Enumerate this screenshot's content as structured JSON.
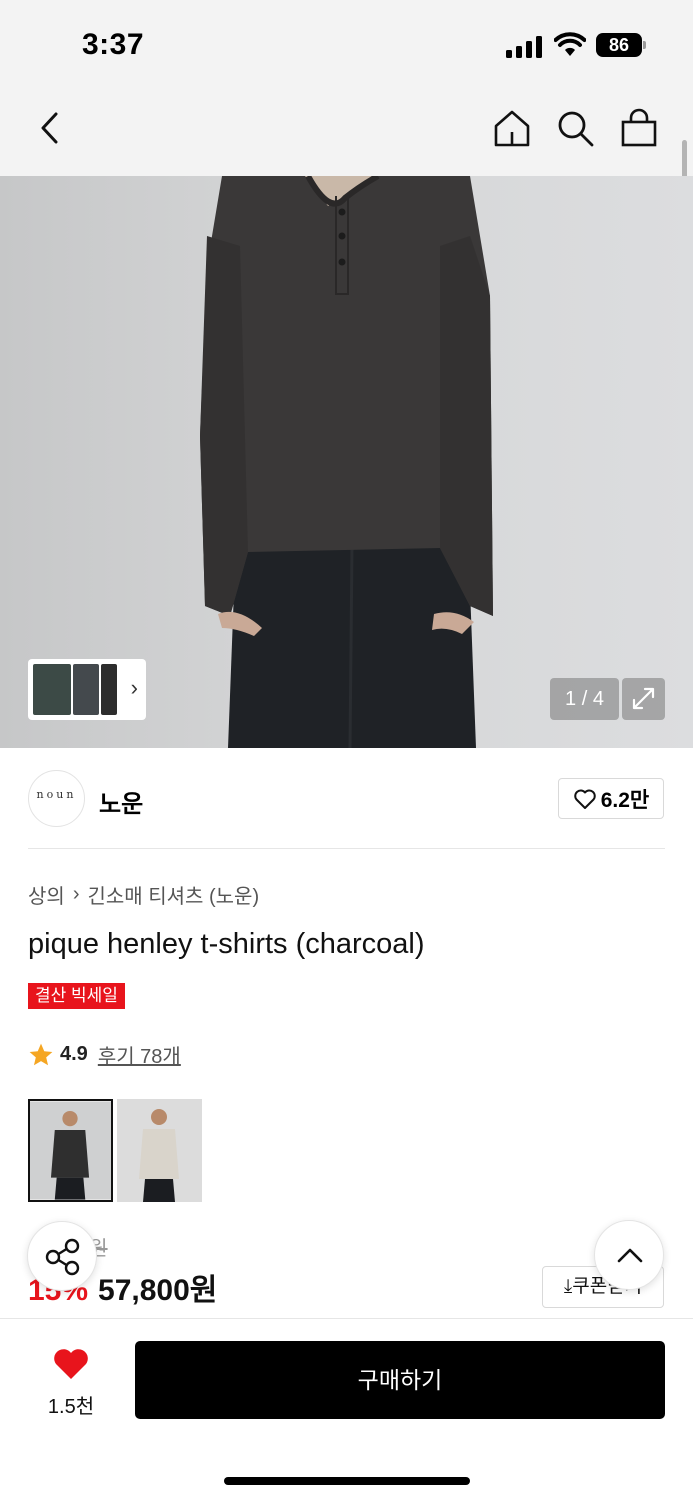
{
  "status_bar": {
    "time": "3:37",
    "battery": "86"
  },
  "nav": {
    "icons": [
      "back-icon",
      "home-icon",
      "search-icon",
      "shopping-bag-icon"
    ]
  },
  "gallery": {
    "counter": "1 / 4"
  },
  "brand": {
    "logo_text": "noun",
    "name": "노운",
    "like_count": "6.2만"
  },
  "product": {
    "breadcrumb": [
      "상의",
      "긴소매 티셔츠 (노운)"
    ],
    "title": "pique henley t-shirts (charcoal)",
    "badge": "결산 빅세일",
    "rating": "4.9",
    "reviews": "후기 78개",
    "colors": [
      {
        "name": "charcoal",
        "hex": "#2f2f2f",
        "selected": true
      },
      {
        "name": "oatmeal",
        "hex": "#d9d4cb",
        "selected": false
      }
    ],
    "original_price": "68,000원",
    "discount": "15%",
    "price": "57,800원",
    "coupon_label": "쿠폰받기"
  },
  "bottom_bar": {
    "wish_count": "1.5천",
    "buy_label": "구매하기"
  },
  "colors": {
    "sale_red": "#e8141c",
    "primary_black": "#000000"
  }
}
